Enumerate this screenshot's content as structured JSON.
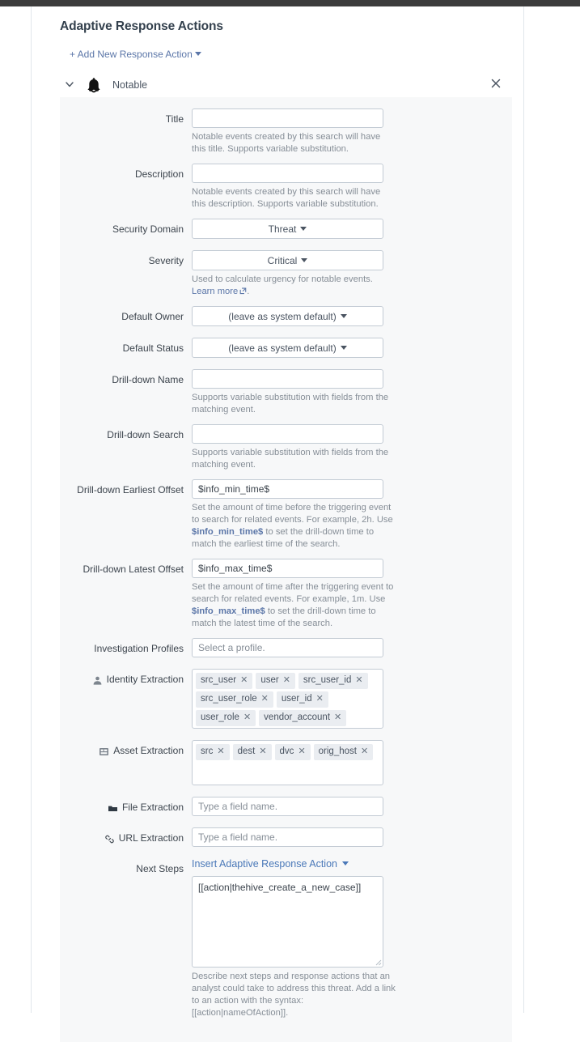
{
  "page": {
    "title": "Adaptive Response Actions",
    "add_action_label": "+ Add New Response Action"
  },
  "action": {
    "name": "Notable",
    "icon": "bell-icon",
    "collapse_icon": "chevron-down-icon",
    "close_icon": "close-icon"
  },
  "fields": {
    "title": {
      "label": "Title",
      "value": "",
      "placeholder": "",
      "hint": "Notable events created by this search will have this title. Supports variable substitution."
    },
    "description": {
      "label": "Description",
      "value": "",
      "placeholder": "",
      "hint": "Notable events created by this search will have this description. Supports variable substitution."
    },
    "security_domain": {
      "label": "Security Domain",
      "value": "Threat"
    },
    "severity": {
      "label": "Severity",
      "value": "Critical",
      "hint_a": "Used to calculate urgency for notable events. ",
      "hint_link": "Learn more",
      "hint_b": "."
    },
    "default_owner": {
      "label": "Default Owner",
      "value": "(leave as system default)"
    },
    "default_status": {
      "label": "Default Status",
      "value": "(leave as system default)"
    },
    "drilldown_name": {
      "label": "Drill-down Name",
      "value": "",
      "hint": "Supports variable substitution with fields from the matching event."
    },
    "drilldown_search": {
      "label": "Drill-down Search",
      "value": "",
      "hint": "Supports variable substitution with fields from the matching event."
    },
    "drilldown_earliest": {
      "label": "Drill-down Earliest Offset",
      "value": "$info_min_time$",
      "hint_a": "Set the amount of time before the triggering event to search for related events. For example, 2h. Use ",
      "hint_code": "$info_min_time$",
      "hint_b": " to set the drill-down time to match the earliest time of the search."
    },
    "drilldown_latest": {
      "label": "Drill-down Latest Offset",
      "value": "$info_max_time$",
      "hint_a": "Set the amount of time after the triggering event to search for related events. For example, 1m. Use ",
      "hint_code": "$info_max_time$",
      "hint_b": " to set the drill-down time to match the latest time of the search."
    },
    "investigation_profiles": {
      "label": "Investigation Profiles",
      "value": "",
      "placeholder": "Select a profile."
    },
    "identity_extraction": {
      "label": "Identity Extraction",
      "icon": "user-icon",
      "tokens": [
        "src_user",
        "user",
        "src_user_id",
        "src_user_role",
        "user_id",
        "user_role",
        "vendor_account"
      ]
    },
    "asset_extraction": {
      "label": "Asset Extraction",
      "icon": "server-icon",
      "tokens": [
        "src",
        "dest",
        "dvc",
        "orig_host"
      ]
    },
    "file_extraction": {
      "label": "File Extraction",
      "icon": "folder-icon",
      "value": "",
      "placeholder": "Type a field name.",
      "tokens": []
    },
    "url_extraction": {
      "label": "URL Extraction",
      "icon": "link-icon",
      "value": "",
      "placeholder": "Type a field name.",
      "tokens": []
    },
    "next_steps": {
      "label": "Next Steps",
      "insert_label": "Insert Adaptive Response Action",
      "value": "[[action|thehive_create_a_new_case]]",
      "hint": "Describe next steps and response actions that an analyst could take to address this threat. Add a link to an action with the syntax: [[action|nameOfAction]]."
    }
  },
  "colors": {
    "link": "#5b76a8",
    "insert_link": "#4a78b8",
    "panel_bg": "#f7f8f9",
    "border": "#c3cbd4",
    "text": "#3c444d",
    "muted": "#868e97",
    "token_bg": "#eaedf1",
    "topbar": "#3c3c3c"
  }
}
